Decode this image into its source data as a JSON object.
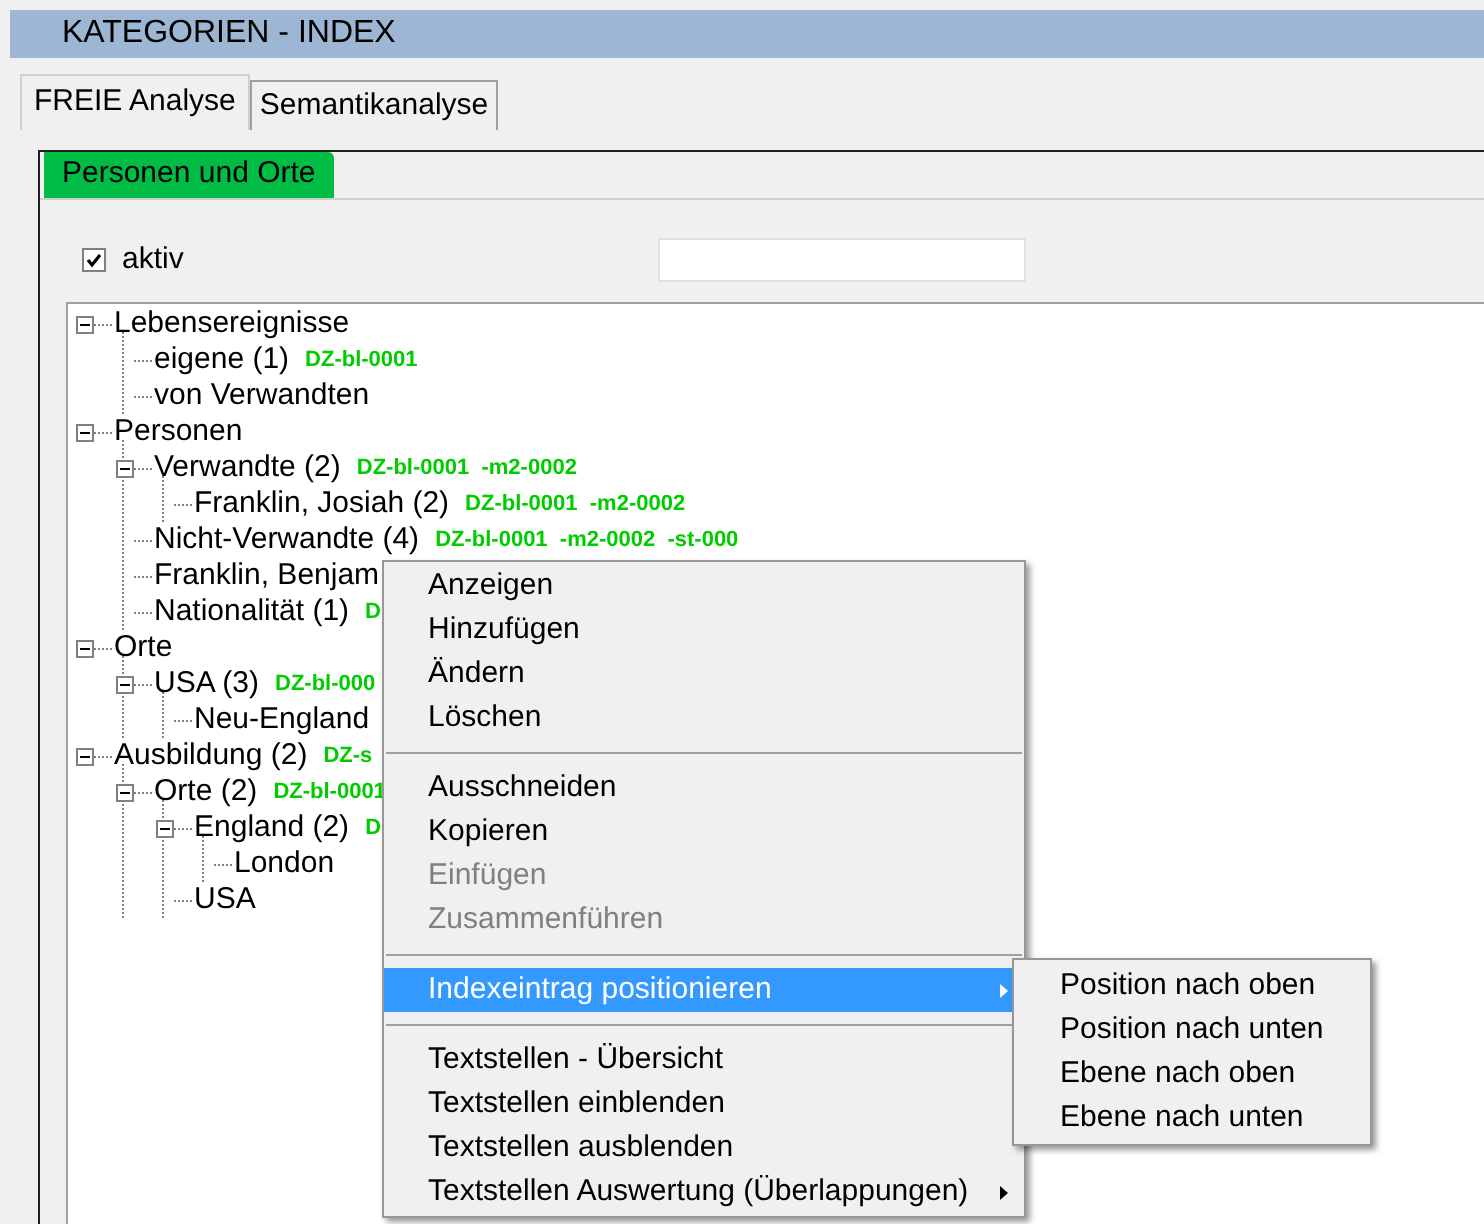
{
  "window": {
    "title": "KATEGORIEN - INDEX"
  },
  "tabs": [
    {
      "label": "FREIE Analyse",
      "selected": true
    },
    {
      "label": "Semantikanalyse",
      "selected": false
    }
  ],
  "category_tab": {
    "label": "Personen und Orte"
  },
  "active_checkbox": {
    "label": "aktiv",
    "checked": true
  },
  "tree": [
    {
      "label": "Lebensereignisse",
      "expanded": true,
      "children": [
        {
          "label": "eigene (1)",
          "codes": "DZ-bl-0001"
        },
        {
          "label": "von Verwandten"
        }
      ]
    },
    {
      "label": "Personen",
      "expanded": true,
      "children": [
        {
          "label": "Verwandte (2)",
          "codes": "DZ-bl-0001  -m2-0002",
          "expanded": true,
          "children": [
            {
              "label": "Franklin, Josiah (2)",
              "codes": "DZ-bl-0001  -m2-0002"
            }
          ]
        },
        {
          "label": "Nicht-Verwandte (4)",
          "codes": "DZ-bl-0001  -m2-0002  -st-000"
        },
        {
          "label": "Franklin, Benjam"
        },
        {
          "label": "Nationalität (1)",
          "codes": "D"
        }
      ]
    },
    {
      "label": "Orte",
      "expanded": true,
      "children": [
        {
          "label": "USA (3)",
          "codes": "DZ-bl-000",
          "expanded": true,
          "children": [
            {
              "label": "Neu-England"
            }
          ]
        }
      ]
    },
    {
      "label": "Ausbildung (2)",
      "codes": "DZ-s",
      "expanded": true,
      "children": [
        {
          "label": "Orte (2)",
          "codes": "DZ-bl-0001",
          "expanded": true,
          "children": [
            {
              "label": "England (2)",
              "codes": "D",
              "expanded": true,
              "children": [
                {
                  "label": "London"
                }
              ]
            },
            {
              "label": "USA"
            }
          ]
        }
      ]
    }
  ],
  "context_menu": {
    "groups": [
      [
        {
          "label": "Anzeigen",
          "disabled": false,
          "selected": false,
          "submenu": false
        },
        {
          "label": "Hinzufügen",
          "disabled": false,
          "selected": false,
          "submenu": false
        },
        {
          "label": "Ändern",
          "disabled": false,
          "selected": false,
          "submenu": false
        },
        {
          "label": "Löschen",
          "disabled": false,
          "selected": false,
          "submenu": false
        }
      ],
      [
        {
          "label": "Ausschneiden",
          "disabled": false,
          "selected": false,
          "submenu": false
        },
        {
          "label": "Kopieren",
          "disabled": false,
          "selected": false,
          "submenu": false
        },
        {
          "label": "Einfügen",
          "disabled": true,
          "selected": false,
          "submenu": false
        },
        {
          "label": "Zusammenführen",
          "disabled": true,
          "selected": false,
          "submenu": false
        }
      ],
      [
        {
          "label": "Indexeintrag positionieren",
          "disabled": false,
          "selected": true,
          "submenu": true
        }
      ],
      [
        {
          "label": "Textstellen - Übersicht",
          "disabled": false,
          "selected": false,
          "submenu": false
        },
        {
          "label": "Textstellen einblenden",
          "disabled": false,
          "selected": false,
          "submenu": false
        },
        {
          "label": "Textstellen ausblenden",
          "disabled": false,
          "selected": false,
          "submenu": false
        },
        {
          "label": "Textstellen Auswertung (Überlappungen)",
          "disabled": false,
          "selected": false,
          "submenu": true
        }
      ]
    ]
  },
  "submenu": [
    {
      "label": "Position nach oben"
    },
    {
      "label": "Position nach unten"
    },
    {
      "label": "Ebene nach oben"
    },
    {
      "label": "Ebene nach unten"
    }
  ]
}
